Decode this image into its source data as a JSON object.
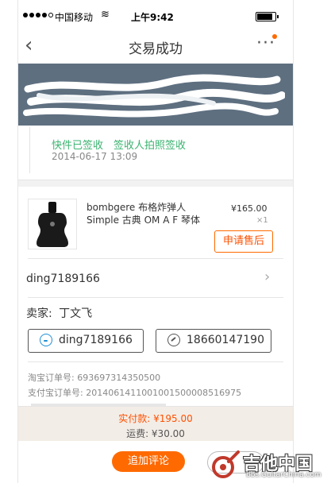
{
  "status_bar": {
    "carrier": "中国移动",
    "time": "上午9:42"
  },
  "nav": {
    "title": "交易成功",
    "back_icon": "chevron-left-icon",
    "more_icon": "more-dots-icon"
  },
  "logistics": {
    "status": "快件已签收　签收人拍照签收",
    "time": "2014-06-17 13:09"
  },
  "product": {
    "name": "bombgere 布格炸弹人 Simple 古典 OM A F 琴体",
    "price": "¥165.00",
    "quantity": "×1",
    "after_sale_label": "申请售后"
  },
  "buyer": {
    "name": "ding7189166"
  },
  "seller": {
    "label": "卖家:",
    "name": "丁文飞"
  },
  "contact": {
    "wangwang": "ding7189166",
    "phone": "18660147190"
  },
  "order_info": {
    "taobao_order": "淘宝订单号:  693697314350500",
    "alipay_order": "支付宝订单号:  2014061411001001500008516975"
  },
  "payment": {
    "paid": "实付款: ¥195.00",
    "shipping": "运费: ¥30.00"
  },
  "actions": {
    "comment_label": "追加评论"
  },
  "watermark": {
    "text": "吉他中国",
    "url": "bbs.GuitarChina.com"
  },
  "colors": {
    "accent": "#ff6a00",
    "banner": "#5e6f80",
    "success": "#3cb371"
  }
}
